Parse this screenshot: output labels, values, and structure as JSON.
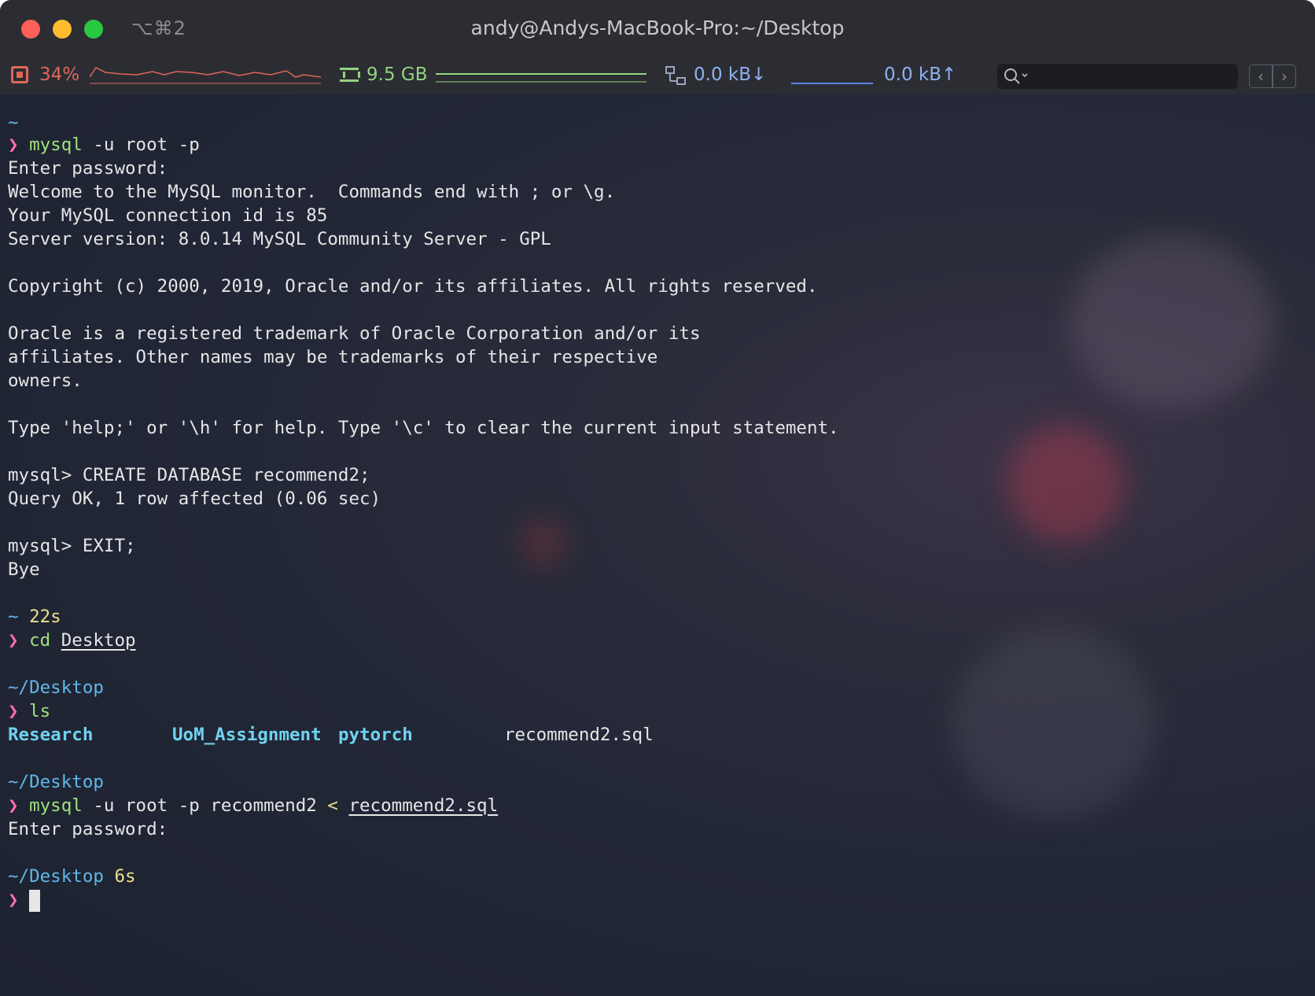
{
  "window": {
    "title": "andy@Andys-MacBook-Pro:~/Desktop",
    "tab_shortcut": "⌥⌘2"
  },
  "status": {
    "cpu": "34%",
    "memory": "9.5 GB",
    "net_down": "0.0 kB↓",
    "net_up": "0.0 kB↑",
    "search_icon": "magnifier-icon",
    "nav_back": "‹",
    "nav_forward": "›"
  },
  "colors": {
    "cpu": "#e0665a",
    "memory": "#95d37c",
    "network": "#5a86e8",
    "prompt_arrow": "#ff6fae",
    "command": "#9fe27a",
    "path": "#5fb8e8",
    "duration": "#e8e08a"
  },
  "terminal": {
    "l01": "~",
    "l02_arrow": "❯",
    "l02_cmd": "mysql",
    "l02_args": " -u root -p",
    "l03": "Enter password:",
    "l04": "Welcome to the MySQL monitor.  Commands end with ; or \\g.",
    "l05": "Your MySQL connection id is 85",
    "l06": "Server version: 8.0.14 MySQL Community Server - GPL",
    "l08": "Copyright (c) 2000, 2019, Oracle and/or its affiliates. All rights reserved.",
    "l10": "Oracle is a registered trademark of Oracle Corporation and/or its",
    "l11": "affiliates. Other names may be trademarks of their respective",
    "l12": "owners.",
    "l14": "Type 'help;' or '\\h' for help. Type '\\c' to clear the current input statement.",
    "l16": "mysql> CREATE DATABASE recommend2;",
    "l17": "Query OK, 1 row affected (0.06 sec)",
    "l19": "mysql> EXIT;",
    "l20": "Bye",
    "l22_path": "~",
    "l22_time": " 22s",
    "l23_arrow": "❯",
    "l23_cmd": "cd",
    "l23_arg": "Desktop",
    "l25_path": "~/Desktop",
    "l26_arrow": "❯",
    "l26_cmd": "ls",
    "ls_items": [
      "Research",
      "UoM_Assignment",
      "pytorch",
      "recommend2.sql"
    ],
    "l29_path": "~/Desktop",
    "l30_arrow": "❯",
    "l30_cmd": "mysql",
    "l30_args": " -u root -p recommend2 ",
    "l30_redirect": "<",
    "l30_file": "recommend2.sql",
    "l31": "Enter password:",
    "l33_path": "~/Desktop",
    "l33_time": " 6s",
    "l34_arrow": "❯"
  }
}
